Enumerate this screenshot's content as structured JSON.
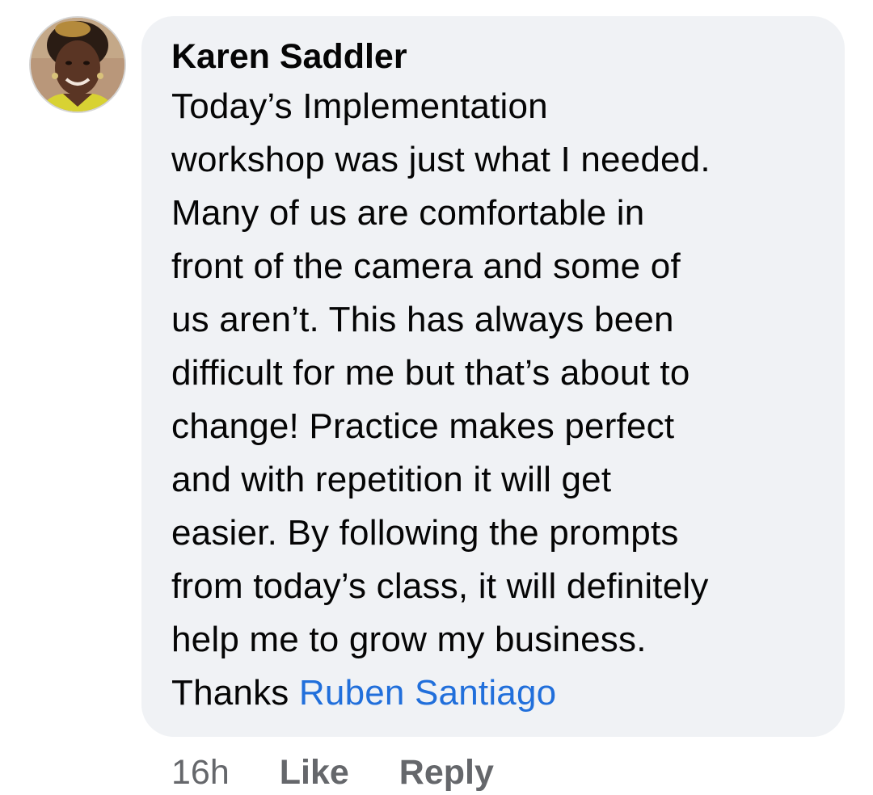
{
  "comment": {
    "author": "Karen Saddler",
    "lines": [
      "Today’s Implementation",
      "workshop was just what I needed.",
      "Many of us are comfortable in",
      "front of the camera and some of",
      "us aren’t. This has always been",
      "difficult for me but that’s about to",
      "change! Practice makes perfect",
      "and with repetition it will get",
      "easier. By following the prompts",
      "from today’s class, it will definitely",
      "help me to grow my business."
    ],
    "closing": "Thanks ",
    "mention": "Ruben Santiago"
  },
  "actions": {
    "time": "16h",
    "like_label": "Like",
    "reply_label": "Reply"
  },
  "colors": {
    "bubble_bg": "#f0f2f5",
    "text": "#050505",
    "mention": "#216fdb",
    "meta": "#65676b"
  },
  "icons": {
    "avatar": "profile-photo"
  }
}
